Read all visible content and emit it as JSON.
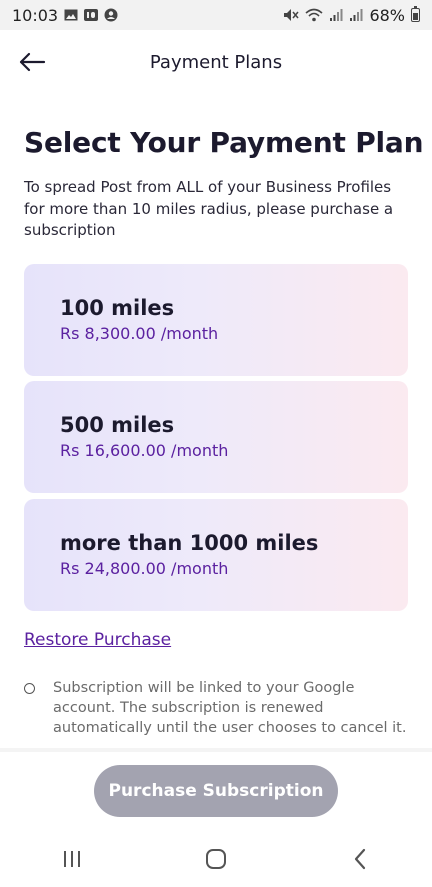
{
  "status_bar": {
    "time": "10:03",
    "battery": "68%"
  },
  "header": {
    "title": "Payment Plans"
  },
  "main": {
    "title": "Select Your Payment Plan",
    "description": "To spread Post from ALL of your Business Profiles for more than 10 miles radius, please purchase a subscription",
    "plans": [
      {
        "name": "100 miles",
        "price": "Rs 8,300.00 /month"
      },
      {
        "name": "500 miles",
        "price": "Rs 16,600.00 /month"
      },
      {
        "name": "more than 1000 miles",
        "price": "Rs 24,800.00 /month"
      }
    ],
    "restore_label": "Restore Purchase",
    "note": "Subscription will be linked to your Google account. The subscription is renewed automatically until the user chooses to cancel it."
  },
  "footer": {
    "purchase_label": "Purchase Subscription"
  },
  "colors": {
    "accent": "#5b21a0",
    "button_disabled": "#a3a3b0",
    "card_gradient_start": "#e6e3fa",
    "card_gradient_end": "#fbeaf0"
  }
}
